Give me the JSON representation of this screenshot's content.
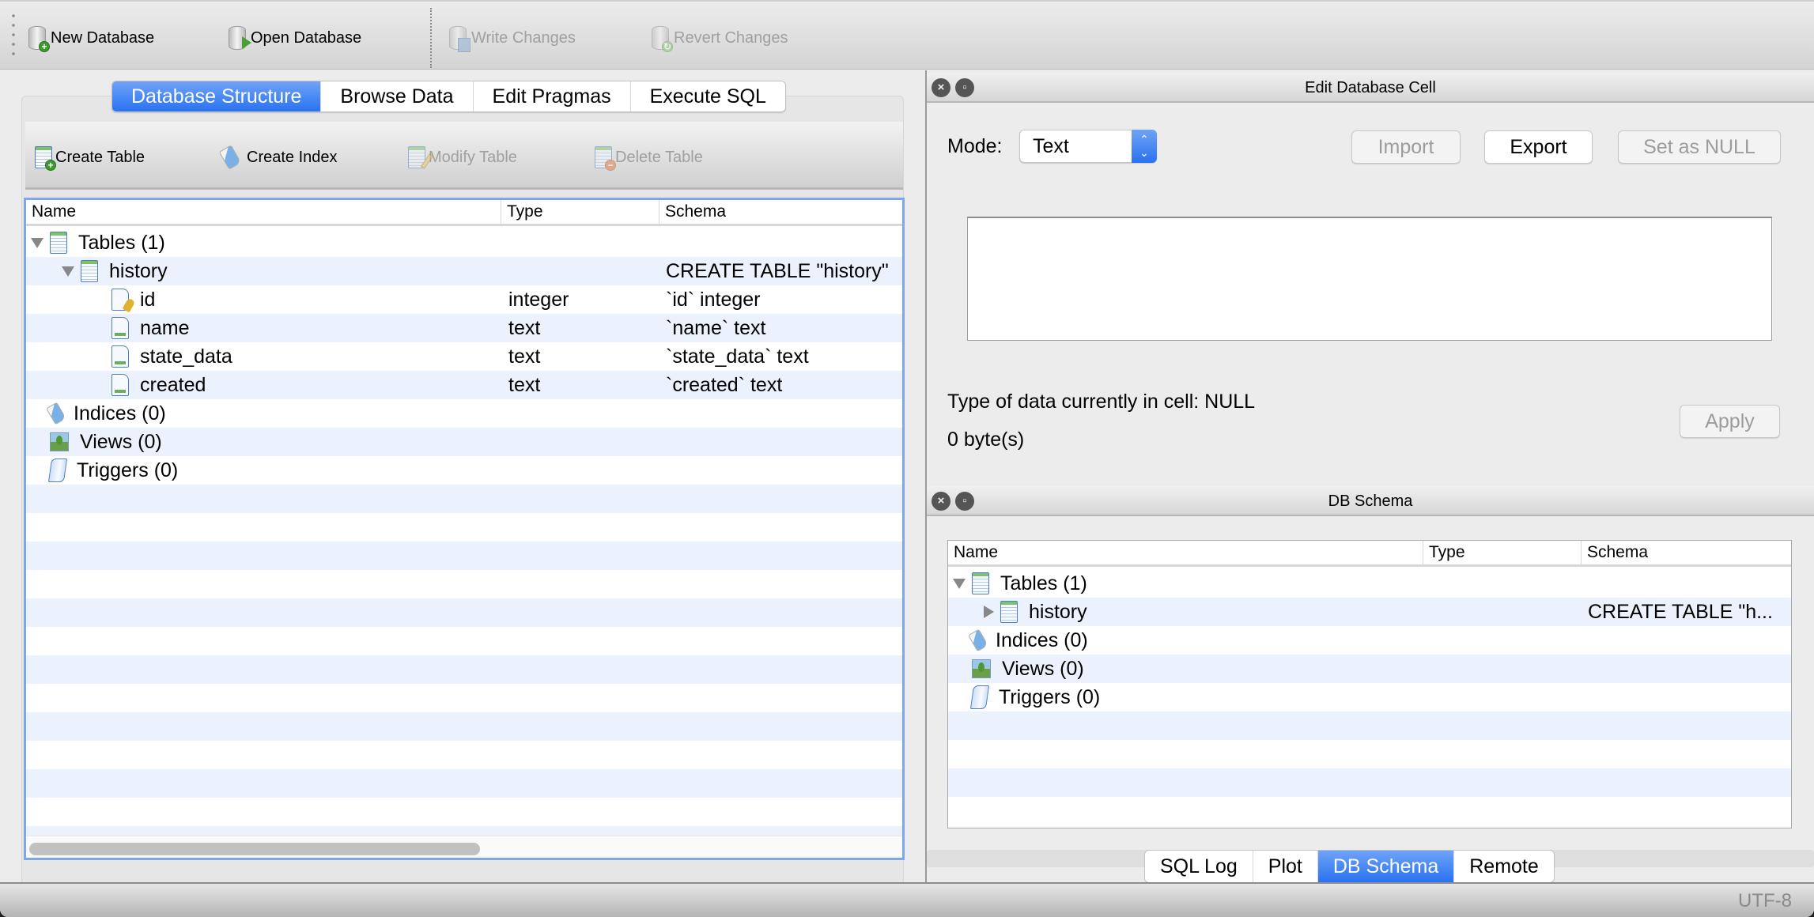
{
  "toolbar": {
    "new_database": "New Database",
    "open_database": "Open Database",
    "write_changes": "Write Changes",
    "revert_changes": "Revert Changes"
  },
  "main_tabs": [
    {
      "label": "Database Structure",
      "active": true
    },
    {
      "label": "Browse Data",
      "active": false
    },
    {
      "label": "Edit Pragmas",
      "active": false
    },
    {
      "label": "Execute SQL",
      "active": false
    }
  ],
  "structure_toolbar": {
    "create_table": "Create Table",
    "create_index": "Create Index",
    "modify_table": "Modify Table",
    "delete_table": "Delete Table"
  },
  "structure_tree": {
    "columns": [
      "Name",
      "Type",
      "Schema"
    ],
    "rows": [
      {
        "name": "Tables (1)",
        "type": "",
        "schema": "",
        "icon": "table-icon",
        "expander": "expanded",
        "level": 0
      },
      {
        "name": "history",
        "type": "",
        "schema": "CREATE TABLE \"history\"",
        "icon": "table-icon",
        "expander": "expanded",
        "level": 1
      },
      {
        "name": "id",
        "type": "integer",
        "schema": "`id` integer",
        "icon": "primary-key-field-icon",
        "expander": "",
        "level": 2
      },
      {
        "name": "name",
        "type": "text",
        "schema": "`name` text",
        "icon": "field-icon",
        "expander": "",
        "level": 2
      },
      {
        "name": "state_data",
        "type": "text",
        "schema": "`state_data` text",
        "icon": "field-icon",
        "expander": "",
        "level": 2
      },
      {
        "name": "created",
        "type": "text",
        "schema": "`created` text",
        "icon": "field-icon",
        "expander": "",
        "level": 2
      },
      {
        "name": "Indices (0)",
        "type": "",
        "schema": "",
        "icon": "index-icon",
        "expander": "",
        "level": 0
      },
      {
        "name": "Views (0)",
        "type": "",
        "schema": "",
        "icon": "view-icon",
        "expander": "",
        "level": 0
      },
      {
        "name": "Triggers (0)",
        "type": "",
        "schema": "",
        "icon": "trigger-icon",
        "expander": "",
        "level": 0
      }
    ]
  },
  "edit_cell": {
    "title": "Edit Database Cell",
    "mode_label": "Mode:",
    "mode_value": "Text",
    "import": "Import",
    "export": "Export",
    "set_null": "Set as NULL",
    "editor_value": "",
    "type_info": "Type of data currently in cell: NULL",
    "size_info": "0 byte(s)",
    "apply": "Apply"
  },
  "db_schema": {
    "title": "DB Schema",
    "columns": [
      "Name",
      "Type",
      "Schema"
    ],
    "rows": [
      {
        "name": "Tables (1)",
        "type": "",
        "schema": "",
        "icon": "table-icon",
        "expander": "expanded",
        "level": 0
      },
      {
        "name": "history",
        "type": "",
        "schema": "CREATE TABLE \"h...",
        "icon": "table-icon",
        "expander": "collapsed",
        "level": 1
      },
      {
        "name": "Indices (0)",
        "type": "",
        "schema": "",
        "icon": "index-icon",
        "expander": "",
        "level": 0
      },
      {
        "name": "Views (0)",
        "type": "",
        "schema": "",
        "icon": "view-icon",
        "expander": "",
        "level": 0
      },
      {
        "name": "Triggers (0)",
        "type": "",
        "schema": "",
        "icon": "trigger-icon",
        "expander": "",
        "level": 0
      }
    ]
  },
  "bottom_tabs": [
    {
      "label": "SQL Log",
      "active": false
    },
    {
      "label": "Plot",
      "active": false
    },
    {
      "label": "DB Schema",
      "active": true
    },
    {
      "label": "Remote",
      "active": false
    }
  ],
  "status": {
    "encoding": "UTF-8"
  },
  "colors": {
    "accent": "#2a72f0",
    "row_alt": "#ebf2fd",
    "focus_border": "#7ea6e8"
  }
}
